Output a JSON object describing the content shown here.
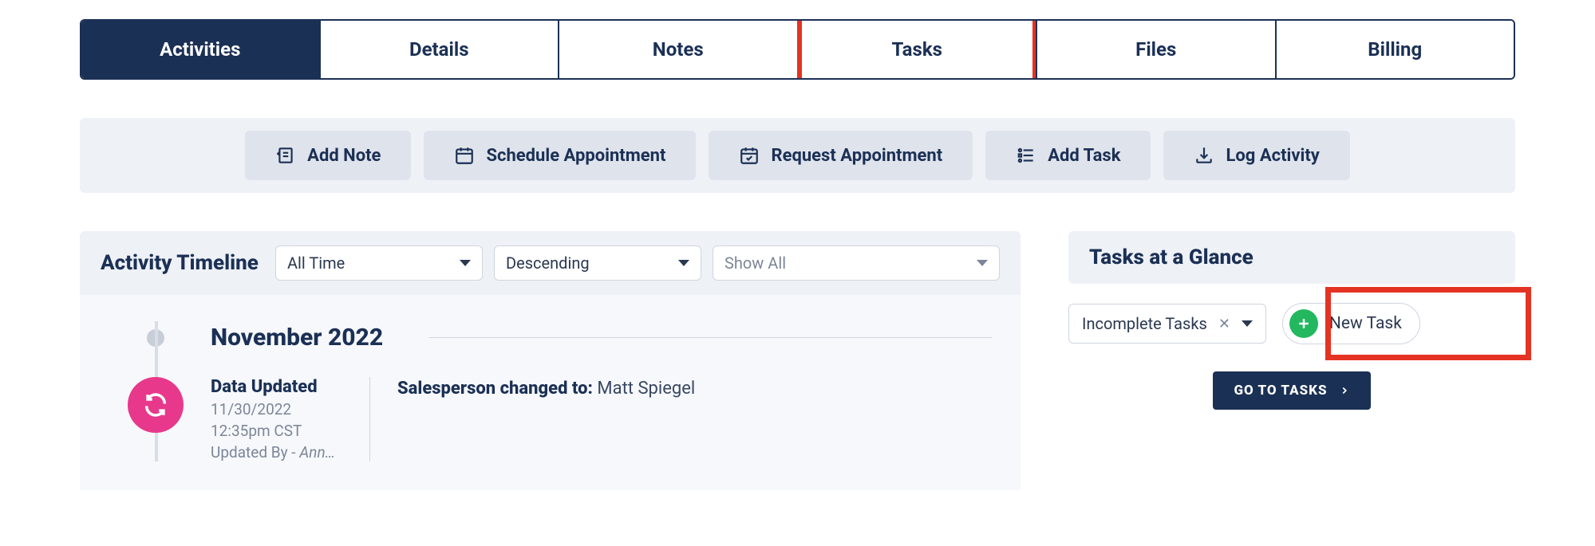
{
  "tabs": {
    "items": [
      {
        "label": "Activities",
        "active": true,
        "highlighted": false
      },
      {
        "label": "Details",
        "active": false,
        "highlighted": false
      },
      {
        "label": "Notes",
        "active": false,
        "highlighted": false
      },
      {
        "label": "Tasks",
        "active": false,
        "highlighted": true
      },
      {
        "label": "Files",
        "active": false,
        "highlighted": false
      },
      {
        "label": "Billing",
        "active": false,
        "highlighted": false
      }
    ]
  },
  "actions": {
    "add_note": "Add Note",
    "schedule_appointment": "Schedule Appointment",
    "request_appointment": "Request Appointment",
    "add_task": "Add Task",
    "log_activity": "Log Activity"
  },
  "timeline": {
    "title": "Activity Timeline",
    "filters": {
      "time_range": "All Time",
      "sort_order": "Descending",
      "show": "Show All"
    },
    "month": "November 2022",
    "event": {
      "title": "Data Updated",
      "date": "11/30/2022",
      "time": "12:35pm CST",
      "updated_by_prefix": "Updated By - ",
      "updated_by_name": "Ann…",
      "description_label": "Salesperson changed to: ",
      "description_value": "Matt Spiegel"
    }
  },
  "tasks": {
    "title": "Tasks at a Glance",
    "filter": "Incomplete Tasks",
    "new_task": "New Task",
    "go_to_tasks": "GO TO TASKS"
  },
  "colors": {
    "highlight": "#e43323",
    "accent_green": "#23b860",
    "accent_pink": "#e8388b",
    "navy": "#1b3055"
  }
}
